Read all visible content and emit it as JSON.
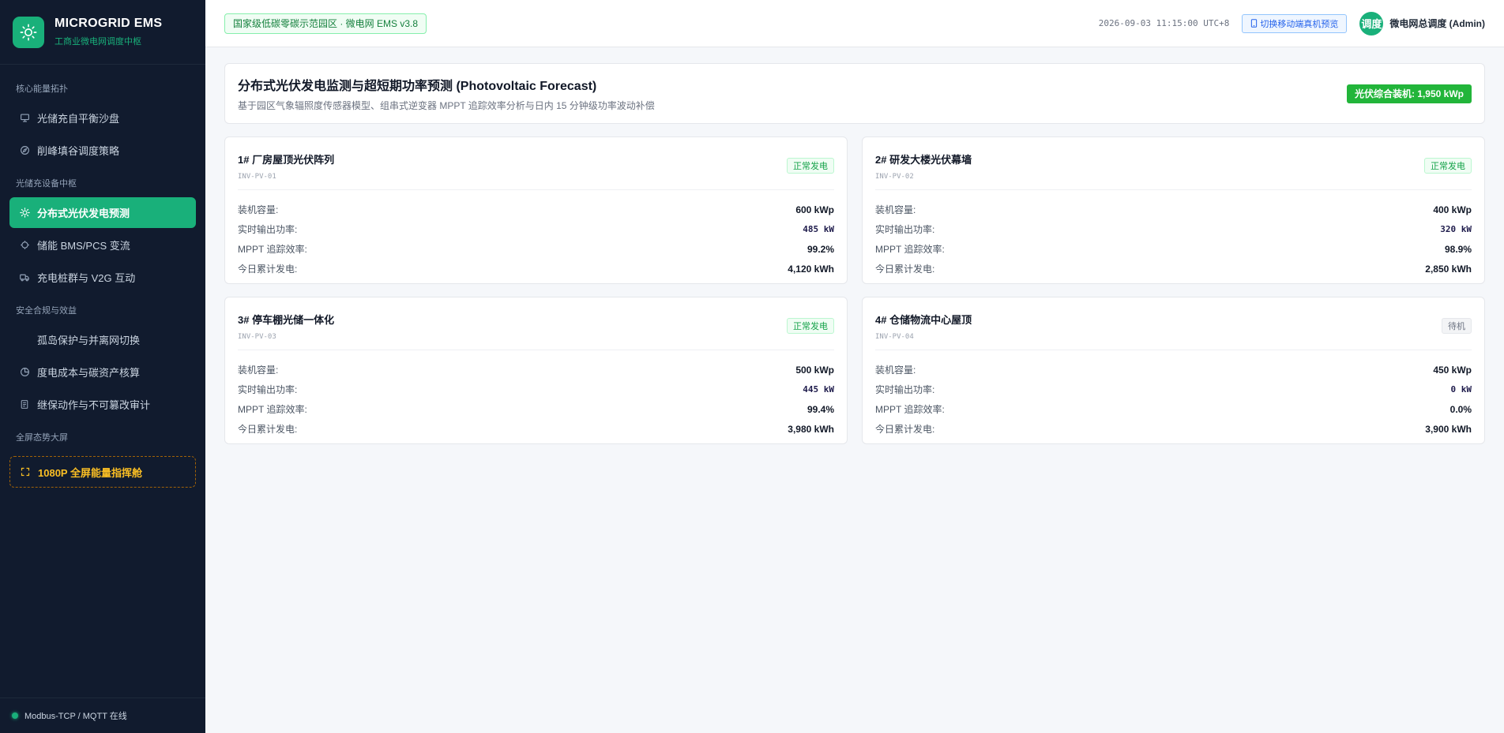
{
  "brand": {
    "title": "MICROGRID EMS",
    "subtitle": "工商业微电网调度中枢",
    "logo_icon": "sun-icon"
  },
  "sidebar": {
    "sections": [
      {
        "label": "核心能量拓扑",
        "items": [
          {
            "label": "光储充自平衡沙盘",
            "icon": "monitor-icon",
            "active": false
          },
          {
            "label": "削峰填谷调度策略",
            "icon": "compass-icon",
            "active": false
          }
        ]
      },
      {
        "label": "光储充设备中枢",
        "items": [
          {
            "label": "分布式光伏发电预测",
            "icon": "sun-icon",
            "active": true
          },
          {
            "label": "储能 BMS/PCS 变流",
            "icon": "chip-icon",
            "active": false
          },
          {
            "label": "充电桩群与 V2G 互动",
            "icon": "truck-icon",
            "active": false
          }
        ]
      },
      {
        "label": "安全合规与效益",
        "items": [
          {
            "label": "孤岛保护与并离网切换",
            "icon": "",
            "active": false
          },
          {
            "label": "度电成本与碳资产核算",
            "icon": "pie-icon",
            "active": false
          },
          {
            "label": "继保动作与不可篡改审计",
            "icon": "document-icon",
            "active": false
          }
        ]
      },
      {
        "label": "全屏态势大屏",
        "items": [
          {
            "label": "1080P 全屏能量指挥舱",
            "icon": "fullscreen-icon",
            "active": false
          }
        ]
      }
    ],
    "footer_status": "Modbus-TCP / MQTT 在线"
  },
  "header": {
    "site_badge": "国家级低碳零碳示范园区 · 微电网 EMS v3.8",
    "timestamp": "2026-09-03 11:15:00 UTC+8",
    "mobile_button": "切换移动端真机预览",
    "avatar_text": "调度",
    "user_name": "微电网总调度 (Admin)"
  },
  "page": {
    "title": "分布式光伏发电监测与超短期功率预测 (Photovoltaic Forecast)",
    "description": "基于园区气象辐照度传感器模型、组串式逆变器 MPPT 追踪效率分析与日内 15 分钟级功率波动补偿",
    "total_badge": "光伏综合装机: 1,950 kWp"
  },
  "field_labels": {
    "capacity": "装机容量:",
    "power": "实时输出功率:",
    "mppt": "MPPT 追踪效率:",
    "energy": "今日累计发电:"
  },
  "arrays": [
    {
      "name": "1# 厂房屋顶光伏阵列",
      "code": "INV-PV-01",
      "status": "正常发电",
      "status_type": "ok",
      "capacity": "600 kWp",
      "power": "485 kW",
      "mppt": "99.2%",
      "energy": "4,120 kWh"
    },
    {
      "name": "2# 研发大楼光伏幕墙",
      "code": "INV-PV-02",
      "status": "正常发电",
      "status_type": "ok",
      "capacity": "400 kWp",
      "power": "320 kW",
      "mppt": "98.9%",
      "energy": "2,850 kWh"
    },
    {
      "name": "3# 停车棚光储一体化",
      "code": "INV-PV-03",
      "status": "正常发电",
      "status_type": "ok",
      "capacity": "500 kWp",
      "power": "445 kW",
      "mppt": "99.4%",
      "energy": "3,980 kWh"
    },
    {
      "name": "4# 仓储物流中心屋顶",
      "code": "INV-PV-04",
      "status": "待机",
      "status_type": "idle",
      "capacity": "450 kWp",
      "power": "0 kW",
      "mppt": "0.0%",
      "energy": "3,900 kWh"
    }
  ],
  "colors": {
    "accent": "#19b07a",
    "sidebar_bg": "#111b2e",
    "warning": "#fbbf24",
    "capacity_badge": "#22b53a"
  }
}
